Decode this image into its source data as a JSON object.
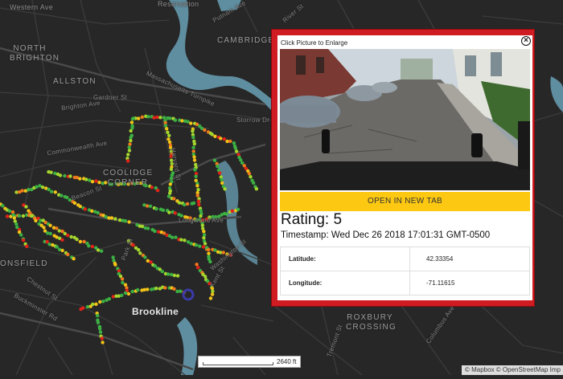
{
  "map": {
    "place_labels": [
      {
        "text": "Western Ave",
        "kind": "road"
      },
      {
        "text": "Reservation",
        "kind": "road"
      },
      {
        "text": "Putnam Ave",
        "kind": "road"
      },
      {
        "text": "River St",
        "kind": "road"
      },
      {
        "text": "CAMBRIDGEPORT",
        "kind": "neighborhood"
      },
      {
        "text": "NORTH BRIGHTON",
        "kind": "neighborhood"
      },
      {
        "text": "ALLSTON",
        "kind": "neighborhood"
      },
      {
        "text": "Gardner St",
        "kind": "road"
      },
      {
        "text": "Brighton Ave",
        "kind": "road"
      },
      {
        "text": "Commonwealth Ave",
        "kind": "road"
      },
      {
        "text": "Massachusetts Turnpike",
        "kind": "road"
      },
      {
        "text": "Storrow Dr",
        "kind": "road"
      },
      {
        "text": "COOLIDGE CORNER",
        "kind": "neighborhood"
      },
      {
        "text": "Beacon St",
        "kind": "road"
      },
      {
        "text": "Longwood Ave",
        "kind": "road"
      },
      {
        "text": "Harvard St",
        "kind": "road"
      },
      {
        "text": "Park St",
        "kind": "road"
      },
      {
        "text": "Kent St",
        "kind": "road"
      },
      {
        "text": "Washington St",
        "kind": "road"
      },
      {
        "text": "Chestnut St",
        "kind": "road"
      },
      {
        "text": "Buckminster Rd",
        "kind": "road"
      },
      {
        "text": "ONSFIELD",
        "kind": "neighborhood"
      },
      {
        "text": "ROXBURY CROSSING",
        "kind": "neighborhood"
      },
      {
        "text": "Tremont St",
        "kind": "road"
      },
      {
        "text": "Columbus Ave",
        "kind": "road"
      }
    ],
    "town_label": "Brookline",
    "rating_colors": {
      "good": "#3cb043",
      "ok": "#a5d62e",
      "fair": "#f2c318",
      "poor": "#f07a1d",
      "bad": "#e2231a"
    },
    "selected_marker_color": "#3a3aa8"
  },
  "popup": {
    "hint": "Click Picture to Enlarge",
    "close_icon": "close-icon",
    "open_button": "OPEN IN NEW TAB",
    "rating": "Rating: 5",
    "timestamp": "Timestamp: Wed Dec 26 2018 17:01:31 GMT-0500",
    "rows": [
      {
        "label": "Latitude:",
        "value": "42.33354"
      },
      {
        "label": "Longitude:",
        "value": "-71.11615"
      }
    ]
  },
  "scale": {
    "label": "2640 ft"
  },
  "attribution": "© Mapbox © OpenStreetMap Imp"
}
